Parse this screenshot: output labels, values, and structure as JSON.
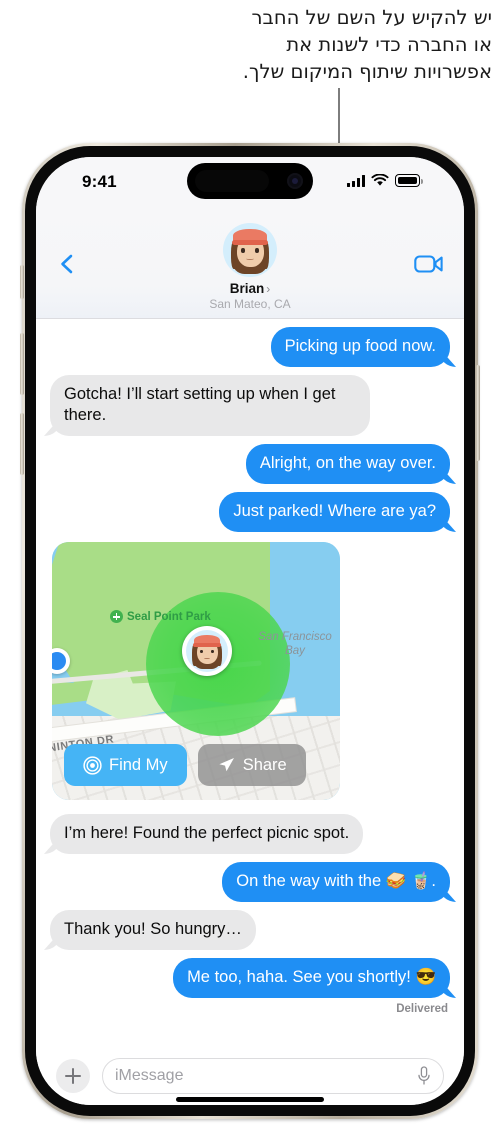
{
  "caption": {
    "lines": [
      "יש להקיש על השם של החבר",
      "או החברה כדי לשנות את",
      "אפשרויות שיתוף המיקום שלך."
    ]
  },
  "status_bar": {
    "time": "9:41",
    "signal_icon": "cellular-bars-icon",
    "wifi_icon": "wifi-icon",
    "battery_icon": "battery-full-icon",
    "battery_level": 100
  },
  "header": {
    "back_icon": "back-chevron-icon",
    "video_icon": "video-camera-icon",
    "avatar_name": "memoji-avatar",
    "contact_name": "Brian",
    "name_chevron": "›",
    "location": "San Mateo, CA"
  },
  "messages": [
    {
      "id": 1,
      "dir": "out",
      "text": "Picking up food now."
    },
    {
      "id": 2,
      "dir": "in",
      "text": "Gotcha! I’ll start setting up when I get there."
    },
    {
      "id": 3,
      "dir": "out",
      "text": "Alright, on the way over."
    },
    {
      "id": 4,
      "dir": "out",
      "text": "Just parked! Where are ya?"
    },
    {
      "id": 5,
      "dir": "in",
      "text": "I’m here! Found the perfect picnic spot."
    },
    {
      "id": 6,
      "dir": "out",
      "text": "On the way with the 🥪 🧋."
    },
    {
      "id": 7,
      "dir": "in",
      "text": "Thank you! So hungry…"
    },
    {
      "id": 8,
      "dir": "out",
      "text": "Me too, haha. See you shortly! 😎"
    }
  ],
  "delivered_label": "Delivered",
  "map_card": {
    "park_label": "Seal Point Park",
    "park_pin_icon": "park-pin-icon",
    "bay_label": "San Francisco Bay",
    "street_label": "NINTON DR",
    "my_location_icon": "my-location-dot-icon",
    "friend_pin_icon": "friend-location-pin-icon",
    "buttons": [
      {
        "label": "Find My",
        "icon": "findmy-radar-icon",
        "style": "primary",
        "color": "#45b4f5"
      },
      {
        "label": "Share",
        "icon": "share-arrow-icon",
        "style": "secondary",
        "color": "#8c8c8c"
      }
    ]
  },
  "composer": {
    "plus_icon": "plus-icon",
    "placeholder": "iMessage",
    "value": "",
    "mic_icon": "microphone-icon"
  },
  "colors": {
    "outgoing_bubble": "#1f8ff4",
    "incoming_bubble": "#e8e8e9",
    "accent_blue": "#1f8ff4",
    "geofence_green": "#40d646",
    "water": "#86cdf0",
    "land": "#a9dd87"
  }
}
